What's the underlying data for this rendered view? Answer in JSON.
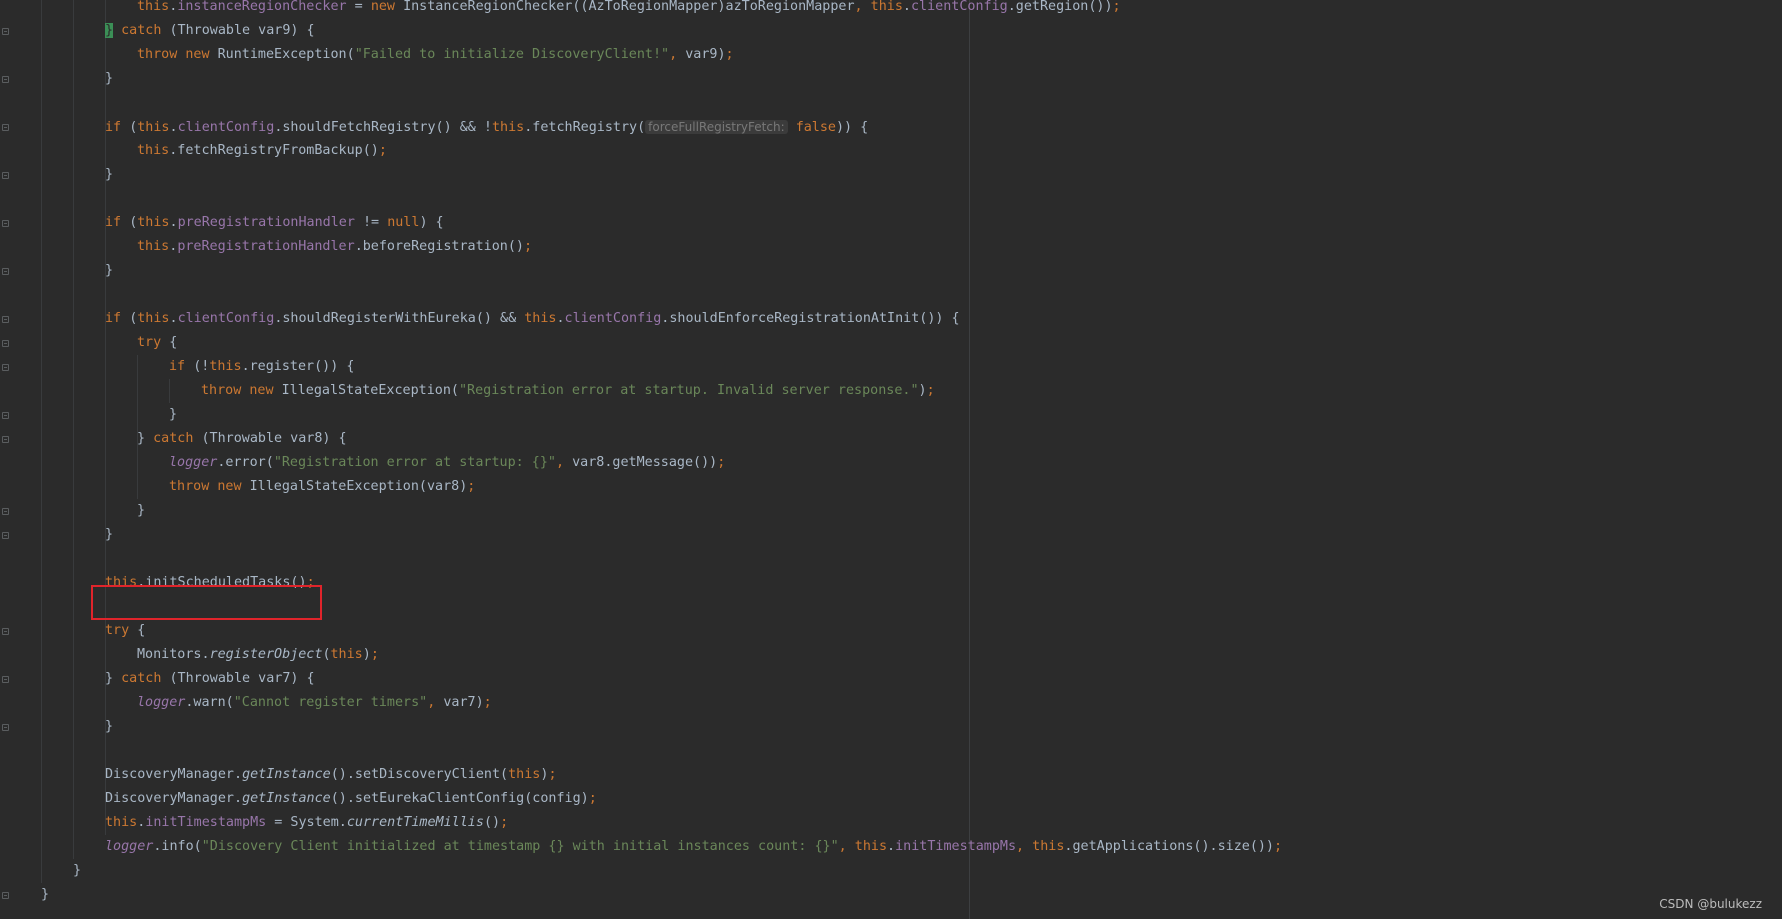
{
  "lines": [
    {
      "indent": 4,
      "tokens": [
        [
          "kw",
          "this"
        ],
        [
          "t",
          "."
        ],
        [
          "field",
          "instanceRegionChecker"
        ],
        [
          "t",
          " = "
        ],
        [
          "kw",
          "new "
        ],
        [
          "t",
          "InstanceRegionChecker((AzToRegionMapper)azToRegionMapper"
        ],
        [
          "kw",
          ", "
        ],
        [
          "kw",
          "this"
        ],
        [
          "t",
          "."
        ],
        [
          "field",
          "clientConfig"
        ],
        [
          "t",
          ".getRegion())"
        ],
        [
          "kw",
          ";"
        ]
      ]
    },
    {
      "indent": 3,
      "tokens": [
        [
          "brace",
          "}"
        ],
        [
          "t",
          " "
        ],
        [
          "kw",
          "catch "
        ],
        [
          "t",
          "(Throwable var9) {"
        ]
      ]
    },
    {
      "indent": 4,
      "tokens": [
        [
          "kw",
          "throw new "
        ],
        [
          "t",
          "RuntimeException("
        ],
        [
          "str",
          "\"Failed to initialize DiscoveryClient!\""
        ],
        [
          "kw",
          ", "
        ],
        [
          "t",
          "var9)"
        ],
        [
          "kw",
          ";"
        ]
      ]
    },
    {
      "indent": 3,
      "tokens": [
        [
          "t",
          "}"
        ]
      ]
    },
    {
      "indent": 0,
      "tokens": []
    },
    {
      "indent": 3,
      "tokens": [
        [
          "kw",
          "if "
        ],
        [
          "t",
          "("
        ],
        [
          "kw",
          "this"
        ],
        [
          "t",
          "."
        ],
        [
          "field",
          "clientConfig"
        ],
        [
          "t",
          ".shouldFetchRegistry() && !"
        ],
        [
          "kw",
          "this"
        ],
        [
          "t",
          ".fetchRegistry("
        ],
        [
          "hint",
          "forceFullRegistryFetch:"
        ],
        [
          "t",
          " "
        ],
        [
          "kw",
          "false"
        ],
        [
          "t",
          ")) {"
        ]
      ]
    },
    {
      "indent": 4,
      "tokens": [
        [
          "kw",
          "this"
        ],
        [
          "t",
          ".fetchRegistryFromBackup()"
        ],
        [
          "kw",
          ";"
        ]
      ]
    },
    {
      "indent": 3,
      "tokens": [
        [
          "t",
          "}"
        ]
      ]
    },
    {
      "indent": 0,
      "tokens": []
    },
    {
      "indent": 3,
      "tokens": [
        [
          "kw",
          "if "
        ],
        [
          "t",
          "("
        ],
        [
          "kw",
          "this"
        ],
        [
          "t",
          "."
        ],
        [
          "field",
          "preRegistrationHandler"
        ],
        [
          "t",
          " != "
        ],
        [
          "kw",
          "null"
        ],
        [
          "t",
          ") {"
        ]
      ]
    },
    {
      "indent": 4,
      "tokens": [
        [
          "kw",
          "this"
        ],
        [
          "t",
          "."
        ],
        [
          "field",
          "preRegistrationHandler"
        ],
        [
          "t",
          ".beforeRegistration()"
        ],
        [
          "kw",
          ";"
        ]
      ]
    },
    {
      "indent": 3,
      "tokens": [
        [
          "t",
          "}"
        ]
      ]
    },
    {
      "indent": 0,
      "tokens": []
    },
    {
      "indent": 3,
      "tokens": [
        [
          "kw",
          "if "
        ],
        [
          "t",
          "("
        ],
        [
          "kw",
          "this"
        ],
        [
          "t",
          "."
        ],
        [
          "field",
          "clientConfig"
        ],
        [
          "t",
          ".shouldRegisterWithEureka() && "
        ],
        [
          "kw",
          "this"
        ],
        [
          "t",
          "."
        ],
        [
          "field",
          "clientConfig"
        ],
        [
          "t",
          ".shouldEnforceRegistrationAtInit()) {"
        ]
      ]
    },
    {
      "indent": 4,
      "tokens": [
        [
          "kw",
          "try "
        ],
        [
          "t",
          "{"
        ]
      ]
    },
    {
      "indent": 5,
      "tokens": [
        [
          "kw",
          "if "
        ],
        [
          "t",
          "(!"
        ],
        [
          "kw",
          "this"
        ],
        [
          "t",
          ".register()) {"
        ]
      ]
    },
    {
      "indent": 6,
      "tokens": [
        [
          "kw",
          "throw new "
        ],
        [
          "t",
          "IllegalStateException("
        ],
        [
          "str",
          "\"Registration error at startup. Invalid server response.\""
        ],
        [
          "t",
          ")"
        ],
        [
          "kw",
          ";"
        ]
      ]
    },
    {
      "indent": 5,
      "tokens": [
        [
          "t",
          "}"
        ]
      ]
    },
    {
      "indent": 4,
      "tokens": [
        [
          "t",
          "} "
        ],
        [
          "kw",
          "catch "
        ],
        [
          "t",
          "(Throwable var8) {"
        ]
      ]
    },
    {
      "indent": 5,
      "tokens": [
        [
          "fstatic",
          "logger"
        ],
        [
          "t",
          ".error("
        ],
        [
          "str",
          "\"Registration error at startup: {}\""
        ],
        [
          "kw",
          ", "
        ],
        [
          "t",
          "var8.getMessage())"
        ],
        [
          "kw",
          ";"
        ]
      ]
    },
    {
      "indent": 5,
      "tokens": [
        [
          "kw",
          "throw new "
        ],
        [
          "t",
          "IllegalStateException(var8)"
        ],
        [
          "kw",
          ";"
        ]
      ]
    },
    {
      "indent": 4,
      "tokens": [
        [
          "t",
          "}"
        ]
      ]
    },
    {
      "indent": 3,
      "tokens": [
        [
          "t",
          "}"
        ]
      ]
    },
    {
      "indent": 0,
      "tokens": []
    },
    {
      "indent": 3,
      "tokens": [
        [
          "kw",
          "this"
        ],
        [
          "t",
          ".initScheduledTasks()"
        ],
        [
          "kw",
          ";"
        ]
      ]
    },
    {
      "indent": 0,
      "tokens": []
    },
    {
      "indent": 3,
      "tokens": [
        [
          "kw",
          "try "
        ],
        [
          "t",
          "{"
        ]
      ]
    },
    {
      "indent": 4,
      "tokens": [
        [
          "t",
          "Monitors."
        ],
        [
          "mstatic",
          "registerObject"
        ],
        [
          "t",
          "("
        ],
        [
          "kw",
          "this"
        ],
        [
          "t",
          ")"
        ],
        [
          "kw",
          ";"
        ]
      ]
    },
    {
      "indent": 3,
      "tokens": [
        [
          "t",
          "} "
        ],
        [
          "kw",
          "catch "
        ],
        [
          "t",
          "(Throwable var7) {"
        ]
      ]
    },
    {
      "indent": 4,
      "tokens": [
        [
          "fstatic",
          "logger"
        ],
        [
          "t",
          ".warn("
        ],
        [
          "str",
          "\"Cannot register timers\""
        ],
        [
          "kw",
          ", "
        ],
        [
          "t",
          "var7)"
        ],
        [
          "kw",
          ";"
        ]
      ]
    },
    {
      "indent": 3,
      "tokens": [
        [
          "t",
          "}"
        ]
      ]
    },
    {
      "indent": 0,
      "tokens": []
    },
    {
      "indent": 3,
      "tokens": [
        [
          "t",
          "DiscoveryManager."
        ],
        [
          "mstatic",
          "getInstance"
        ],
        [
          "t",
          "().setDiscoveryClient("
        ],
        [
          "kw",
          "this"
        ],
        [
          "t",
          ")"
        ],
        [
          "kw",
          ";"
        ]
      ]
    },
    {
      "indent": 3,
      "tokens": [
        [
          "t",
          "DiscoveryManager."
        ],
        [
          "mstatic",
          "getInstance"
        ],
        [
          "t",
          "().setEurekaClientConfig(config)"
        ],
        [
          "kw",
          ";"
        ]
      ]
    },
    {
      "indent": 3,
      "tokens": [
        [
          "kw",
          "this"
        ],
        [
          "t",
          "."
        ],
        [
          "field",
          "initTimestampMs"
        ],
        [
          "t",
          " = System."
        ],
        [
          "mstatic",
          "currentTimeMillis"
        ],
        [
          "t",
          "()"
        ],
        [
          "kw",
          ";"
        ]
      ]
    },
    {
      "indent": 3,
      "tokens": [
        [
          "fstatic",
          "logger"
        ],
        [
          "t",
          ".info("
        ],
        [
          "str",
          "\"Discovery Client initialized at timestamp {} with initial instances count: {}\""
        ],
        [
          "kw",
          ", "
        ],
        [
          "kw",
          "this"
        ],
        [
          "t",
          "."
        ],
        [
          "field",
          "initTimestampMs"
        ],
        [
          "kw",
          ", "
        ],
        [
          "kw",
          "this"
        ],
        [
          "t",
          ".getApplications().size())"
        ],
        [
          "kw",
          ";"
        ]
      ]
    },
    {
      "indent": 2,
      "tokens": [
        [
          "t",
          "}"
        ]
      ]
    },
    {
      "indent": 1,
      "tokens": [
        [
          "t",
          "}"
        ]
      ]
    }
  ],
  "watermark": "CSDN @bulukezz",
  "colors": {
    "background": "#2b2b2b",
    "default_text": "#a9b7c6",
    "keyword": "#cc7832",
    "field": "#9876aa",
    "string": "#6a8759",
    "highlight_box": "#e0242b",
    "brace_match": "#3b8f56"
  }
}
